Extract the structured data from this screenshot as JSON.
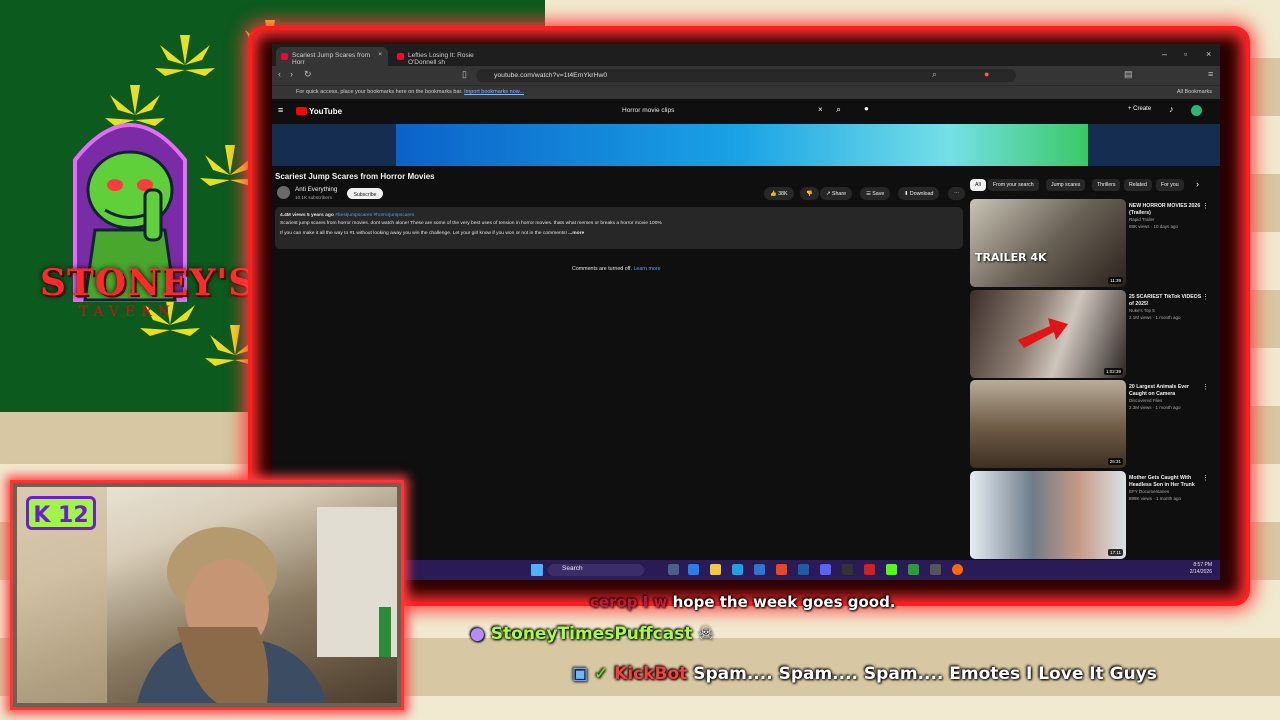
{
  "browser": {
    "tabs": [
      {
        "label": "Scariest Jump Scares from Horr",
        "active": true
      },
      {
        "label": "Lefties Losing It: Rosie O'Donnell sh",
        "active": false
      }
    ],
    "url": "youtube.com/watch?v=1t4EmYkrHw0",
    "bookmarks_bar_text": "For quick access, place your bookmarks here on the bookmarks bar.",
    "bookmarks_bar_link": "Import bookmarks now...",
    "all_bookmarks": "All Bookmarks"
  },
  "youtube": {
    "logo": "YouTube",
    "search_query": "Horror movie clips",
    "create_label": "Create",
    "video_title": "Scariest Jump Scares from Horror Movies",
    "channel": "Anti Everything",
    "subscribers": "10.1K subscribers",
    "subscribe_label": "Subscribe",
    "likes": "38K",
    "actions": {
      "share": "Share",
      "save": "Save",
      "download": "Download"
    },
    "description": {
      "meta": "4.4M views  5 years ago",
      "tags": "#bestjumpscares #horrorjumpscares",
      "line1": "Scariest jump scares from horror movies. dont watch alone! These are some of the very best uses of tension in horror movies. thats what memes or breaks a horror movie 100%",
      "line2": "If you can make it all the way to #1 without looking away you win the challenge. Let your girl know if you won or not in the comments!",
      "more": "...more"
    },
    "comments_off": "Comments are turned off.",
    "learn_more": "Learn more",
    "chips": [
      "All",
      "From your search",
      "Jump scares",
      "Thrillers",
      "Related",
      "For you"
    ],
    "recommendations": [
      {
        "title": "NEW HORROR MOVIES 2026 (Trailers)",
        "channel": "Rapid Trailer",
        "meta": "88K views · 10 days ago",
        "duration": "11:39",
        "thumb_text": "TRAILER 4K"
      },
      {
        "title": "25 SCARIEST TikTok VIDEOS of 2025!",
        "channel": "Nuke's Top 5",
        "meta": "2.1M views · 1 month ago",
        "duration": "1:02:39"
      },
      {
        "title": "20 Largest Animals Ever Caught on Camera",
        "channel": "Discovered Files",
        "meta": "2.3M views · 1 month ago",
        "duration": "26:31"
      },
      {
        "title": "Mother Gets Caught With Headless Son in Her Trunk",
        "channel": "EFY Documentaries",
        "meta": "898K views · 1 month ago",
        "duration": "17:11"
      }
    ]
  },
  "taskbar": {
    "search": "Search",
    "time": "8:57 PM",
    "date": "2/14/2026"
  },
  "overlay": {
    "logo_text": "STONEY'S",
    "logo_sub": "TAVERN",
    "kick_badge": "K 12"
  },
  "chat": {
    "line1_faded": "cerop I w",
    "line1": "hope the week goes good.",
    "line2_user": "StoneyTimesPuffcast",
    "line3_user": "KickBot",
    "line3_msg": "Spam.... Spam.... Spam.... Emotes I Love It Guys"
  },
  "colors": {
    "frame_glow": "#ff1e1e",
    "yt_red": "#ff0000",
    "chat_green": "#a5ff3a",
    "kick_green": "#a4f34d"
  }
}
